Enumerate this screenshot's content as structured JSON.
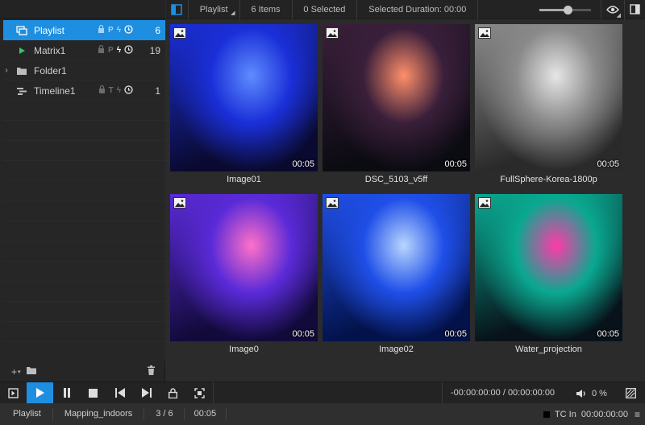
{
  "topbar": {
    "mode": "Playlist",
    "items": "6 Items",
    "selected": "0 Selected",
    "duration": "Selected Duration: 00:00",
    "zoom_percent": 55
  },
  "tree": [
    {
      "name": "Playlist",
      "flags": [
        "🔒",
        "P",
        "ϟ"
      ],
      "count": "6",
      "selected": true,
      "icon": "playlist-icon"
    },
    {
      "name": "Matrix1",
      "flags": [
        "🔒",
        "P",
        "ϟ"
      ],
      "count": "19",
      "selected": false,
      "icon": "play-triangle-icon"
    },
    {
      "name": "Folder1",
      "flags": [],
      "count": "",
      "selected": false,
      "icon": "folder-icon"
    },
    {
      "name": "Timeline1",
      "flags": [
        "🔒",
        "T",
        "ϟ"
      ],
      "count": "1",
      "selected": false,
      "icon": "timeline-icon"
    }
  ],
  "media": [
    {
      "name": "Image01",
      "duration": "00:05",
      "palette": [
        "#0a0a30",
        "#1a2fd8",
        "#5f8cff"
      ]
    },
    {
      "name": "DSC_5103_v5ff",
      "duration": "00:05",
      "palette": [
        "#0b0b12",
        "#3a1f3a",
        "#ff8f6a"
      ]
    },
    {
      "name": "FullSphere-Korea-1800p",
      "duration": "00:05",
      "palette": [
        "#2a2a2a",
        "#8a8a8a",
        "#e6e6e6"
      ]
    },
    {
      "name": "Image0",
      "duration": "00:05",
      "palette": [
        "#120a3a",
        "#5a2ad8",
        "#ff70c8"
      ]
    },
    {
      "name": "Image02",
      "duration": "00:05",
      "palette": [
        "#03124a",
        "#1f4fe8",
        "#b8d6ff"
      ]
    },
    {
      "name": "Water_projection",
      "duration": "00:05",
      "palette": [
        "#08121a",
        "#0aa890",
        "#ff3aa8"
      ]
    }
  ],
  "transport": {
    "timecode": "-00:00:00:00 / 00:00:00:00",
    "volume": "0 %"
  },
  "status": {
    "mode": "Playlist",
    "project": "Mapping_indoors",
    "position": "3 / 6",
    "duration": "00:05",
    "tc_label": "TC In",
    "tc_value": "00:00:00:00"
  },
  "colors": {
    "accent": "#1e8fe0"
  }
}
